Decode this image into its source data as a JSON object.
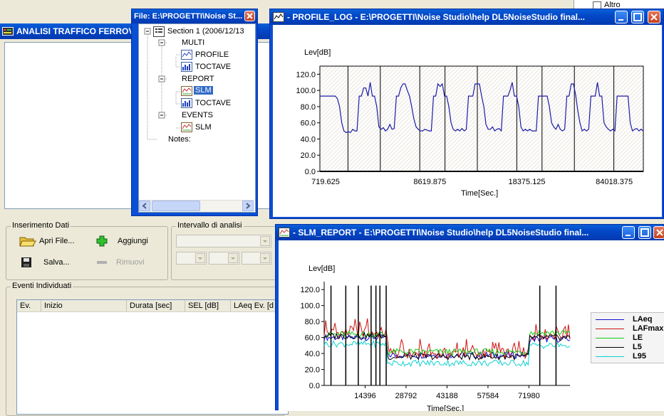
{
  "main_window": {
    "title": "ANALISI TRAFFICO FERROV",
    "close_label": "X",
    "inserimento": {
      "label": "Inserimento Dati",
      "open_label": "Apri File...",
      "add_label": "Aggiungi",
      "save_label": "Salva...",
      "remove_label": "Rimuovi"
    },
    "intervallo": {
      "label": "Intervallo di analisi"
    },
    "eventi": {
      "label": "Eventi Individuati",
      "columns": [
        "Ev.",
        "Inizio",
        "Durata [sec]",
        "SEL [dB]",
        "LAeq Ev. [d"
      ]
    }
  },
  "right_panel": {
    "item_label": "Altro"
  },
  "file_window": {
    "title": "File: E:\\PROGETTI\\Noise St...",
    "tree": {
      "section": "Section 1   (2006/12/13",
      "multi": "MULTI",
      "profile": "PROFILE",
      "toctave1": "TOCTAVE",
      "report": "REPORT",
      "slm1": "SLM",
      "toctave2": "TOCTAVE",
      "events": "EVENTS",
      "slm2": "SLM",
      "notes": "Notes:"
    }
  },
  "profile_window": {
    "title": " - PROFILE_LOG -     E:\\PROGETTI\\Noise Studio\\help DL5NoiseStudio final..."
  },
  "slm_window": {
    "title": " - SLM_REPORT -     E:\\PROGETTI\\Noise Studio\\help DL5NoiseStudio final..."
  },
  "profile_chart": {
    "chart_data": {
      "type": "line",
      "ylabel": "Lev[dB]",
      "xlabel": "Time[Sec.]",
      "yticks": [
        "120.0",
        "100.0",
        "80.0",
        "60.0",
        "40.0",
        "20.0",
        "0.0"
      ],
      "ylim": [
        0,
        130
      ],
      "xticks": [
        "719.625",
        "8619.875",
        "18375.125",
        "84018.375"
      ],
      "grid": "hatched",
      "segments": 10,
      "series": [
        {
          "color": "#1c1ca8",
          "values": [
            93,
            93,
            93,
            93,
            93,
            93,
            93,
            93,
            90,
            80,
            60,
            50,
            48,
            49,
            48,
            52,
            50,
            50,
            93,
            93,
            103,
            103,
            93,
            110,
            93,
            93,
            80,
            55,
            52,
            54,
            50,
            52,
            58,
            52,
            53,
            93,
            93,
            103,
            108,
            108,
            100,
            93,
            80,
            65,
            55,
            52,
            50,
            50,
            52,
            51,
            50,
            50,
            93,
            93,
            108,
            105,
            108,
            93,
            93,
            80,
            60,
            52,
            50,
            52,
            50,
            53,
            50,
            52,
            93,
            93,
            93,
            108,
            108,
            108,
            93,
            80,
            58,
            52,
            52,
            55,
            50,
            52,
            53,
            50,
            93,
            93,
            93,
            100,
            110,
            93,
            93,
            80,
            55,
            50,
            52,
            50,
            52,
            50,
            50,
            50,
            93,
            93,
            93,
            93,
            93,
            80,
            60,
            55,
            52,
            58,
            52,
            50,
            52,
            93,
            93,
            108,
            108,
            95,
            75,
            60,
            50,
            52,
            50,
            52,
            93,
            93,
            93,
            110,
            93,
            93,
            60,
            55,
            52,
            50,
            52,
            50,
            93,
            93,
            93,
            93,
            93,
            93,
            60,
            50,
            52,
            53,
            50,
            52,
            50
          ]
        }
      ]
    }
  },
  "slm_chart": {
    "chart_data": {
      "type": "line",
      "ylabel": "Lev[dB]",
      "xlabel": "Time[Sec.]",
      "yticks": [
        "120.0",
        "100.0",
        "80.0",
        "60.0",
        "40.0",
        "20.0",
        "0.0"
      ],
      "ylim": [
        0,
        130
      ],
      "xticks": [
        "14396",
        "28792",
        "43188",
        "57584",
        "71980"
      ],
      "xlim": [
        0,
        86400
      ],
      "series": [
        {
          "name": "LAeq",
          "color": "#1010d0",
          "base": [
            60,
            38,
            58
          ]
        },
        {
          "name": "LAFmax",
          "color": "#d01010",
          "base": [
            66,
            40,
            64
          ]
        },
        {
          "name": "LE",
          "color": "#10d010",
          "base": [
            64,
            42,
            66
          ]
        },
        {
          "name": "L5",
          "color": "#000000",
          "base": [
            62,
            36,
            60
          ]
        },
        {
          "name": "L95",
          "color": "#10d0d0",
          "base": [
            52,
            28,
            50
          ]
        }
      ]
    }
  }
}
